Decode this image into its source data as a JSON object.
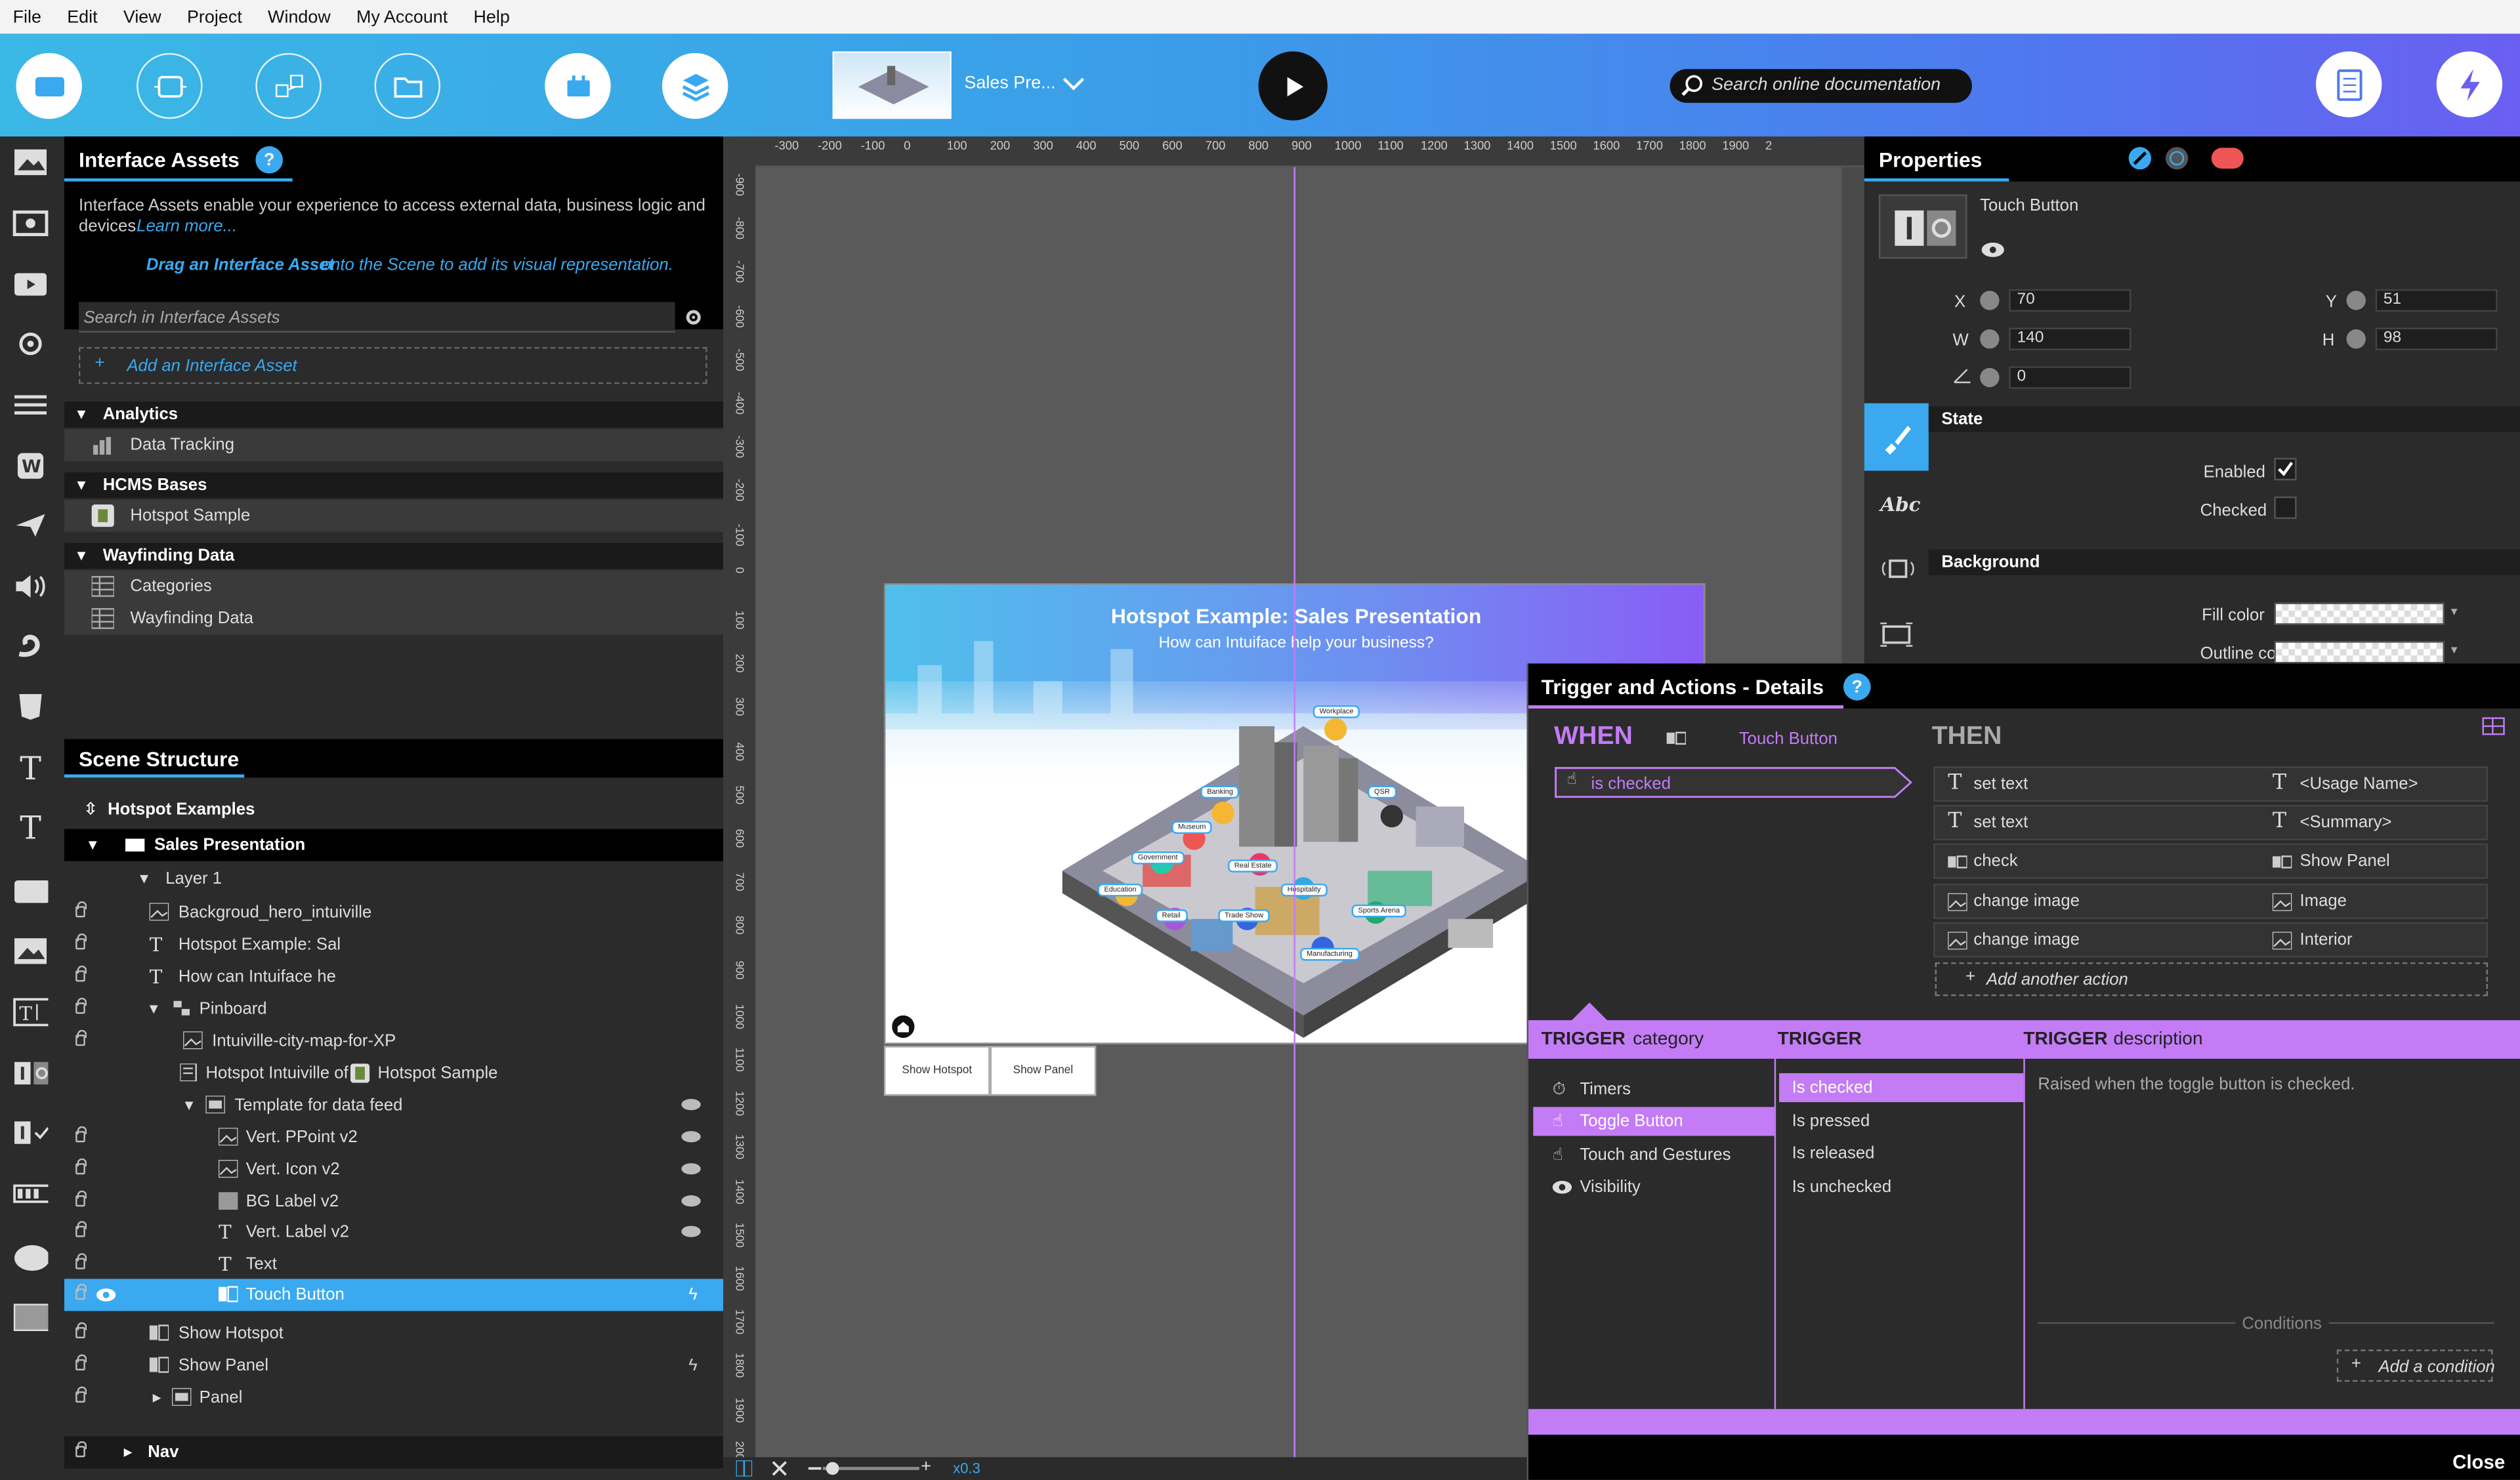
{
  "menu": [
    "File",
    "Edit",
    "View",
    "Project",
    "Window",
    "My Account",
    "Help"
  ],
  "toolbar": {
    "project_title": "Sales Pre...",
    "search_placeholder": "Search online documentation"
  },
  "interface_assets": {
    "title": "Interface Assets",
    "help": "?",
    "desc1": "Interface Assets enable your experience to access external data, business logic and",
    "desc2": "devices.",
    "learn_more": "Learn more...",
    "drag_bold": "Drag an Interface Asset",
    "drag_rest": " onto the Scene to add its visual representation.",
    "search_placeholder": "Search in Interface Assets",
    "add": "Add an Interface Asset",
    "sections": [
      {
        "name": "Analytics",
        "items": [
          "Data Tracking"
        ]
      },
      {
        "name": "HCMS Bases",
        "items": [
          "Hotspot Sample"
        ]
      },
      {
        "name": "Wayfinding Data",
        "items": [
          "Categories",
          "Wayfinding Data"
        ]
      }
    ]
  },
  "scene_structure": {
    "title": "Scene Structure",
    "root": "Hotspot Examples",
    "scene": "Sales Presentation",
    "layer": "Layer 1",
    "items": {
      "bg": "Backgroud_hero_intuiville",
      "t1": "Hotspot Example: Sal",
      "t2": "How can Intuiface he",
      "pinboard": "Pinboard",
      "map": "Intuiville-city-map-for-XP",
      "hotspot_of": "Hotspot Intuiville of",
      "hotspot_src": "Hotspot Sample",
      "template": "Template for data feed",
      "ppoint": "Vert. PPoint v2",
      "icon": "Vert. Icon v2",
      "bglabel": "BG Label v2",
      "vlabel": "Vert. Label v2",
      "text": "Text",
      "touch": "Touch Button",
      "showhot": "Show Hotspot",
      "showpanel": "Show Panel",
      "panel": "Panel",
      "nav": "Nav"
    }
  },
  "canvas": {
    "ruler_top": [
      "-300",
      "-200",
      "-100",
      "0",
      "100",
      "200",
      "300",
      "400",
      "500",
      "600",
      "700",
      "800",
      "900",
      "1000",
      "1100",
      "1200",
      "1300",
      "1400",
      "1500",
      "1600",
      "1700",
      "1800",
      "1900",
      "2"
    ],
    "ruler_left": [
      "-900",
      "-800",
      "-700",
      "-600",
      "-500",
      "-400",
      "-300",
      "-200",
      "-100",
      "0",
      "100",
      "200",
      "300",
      "400",
      "500",
      "600",
      "700",
      "800",
      "900",
      "1000",
      "1100",
      "1200",
      "1300",
      "1400",
      "1500",
      "1600",
      "1700",
      "1800",
      "1900",
      "2000"
    ],
    "zoom": "x0.3",
    "scene_title": "Hotspot Example: Sales Presentation",
    "scene_subtitle": "How can Intuiface help your business?",
    "map_labels": [
      "Workplace",
      "Banking",
      "QSR",
      "Museum",
      "Government",
      "Real Estate",
      "Education",
      "Hospitality",
      "Retail",
      "Trade Show",
      "Sports Arena",
      "Manufacturing"
    ],
    "btn1": "Show Hotspot",
    "btn2": "Show Panel"
  },
  "properties": {
    "title": "Properties",
    "name": "Touch Button",
    "x_label": "X",
    "x": "70",
    "y_label": "Y",
    "y": "51",
    "w_label": "W",
    "w": "140",
    "h_label": "H",
    "h": "98",
    "angle": "0",
    "state_hdr": "State",
    "enabled": "Enabled",
    "checked": "Checked",
    "bg_hdr": "Background",
    "fill": "Fill color",
    "outline": "Outline color"
  },
  "trigger": {
    "title": "Trigger and Actions - Details",
    "help": "?",
    "when": "WHEN",
    "when_target": "Touch Button",
    "when_event": "is checked",
    "then": "THEN",
    "actions": [
      {
        "verb": "set text",
        "target": "<Usage Name>"
      },
      {
        "verb": "set text",
        "target": "<Summary>"
      },
      {
        "verb": "check",
        "target": "Show Panel"
      },
      {
        "verb": "change image",
        "target": "Image"
      },
      {
        "verb": "change image",
        "target": "Interior"
      }
    ],
    "add_action": "Add another action",
    "cat_hdr_bold": "TRIGGER",
    "cat_hdr_rest": "category",
    "trig_hdr": "TRIGGER",
    "desc_hdr_bold": "TRIGGER",
    "desc_hdr_rest": "description",
    "categories": [
      "Timers",
      "Toggle Button",
      "Touch and Gestures",
      "Visibility"
    ],
    "triggers": [
      "Is checked",
      "Is pressed",
      "Is released",
      "Is unchecked"
    ],
    "description": "Raised when the toggle button is checked.",
    "conditions": "Conditions",
    "add_condition": "Add a condition",
    "close": "Close"
  },
  "colors": {
    "accent": "#3aa9f0",
    "trigger": "#c37cf5"
  }
}
